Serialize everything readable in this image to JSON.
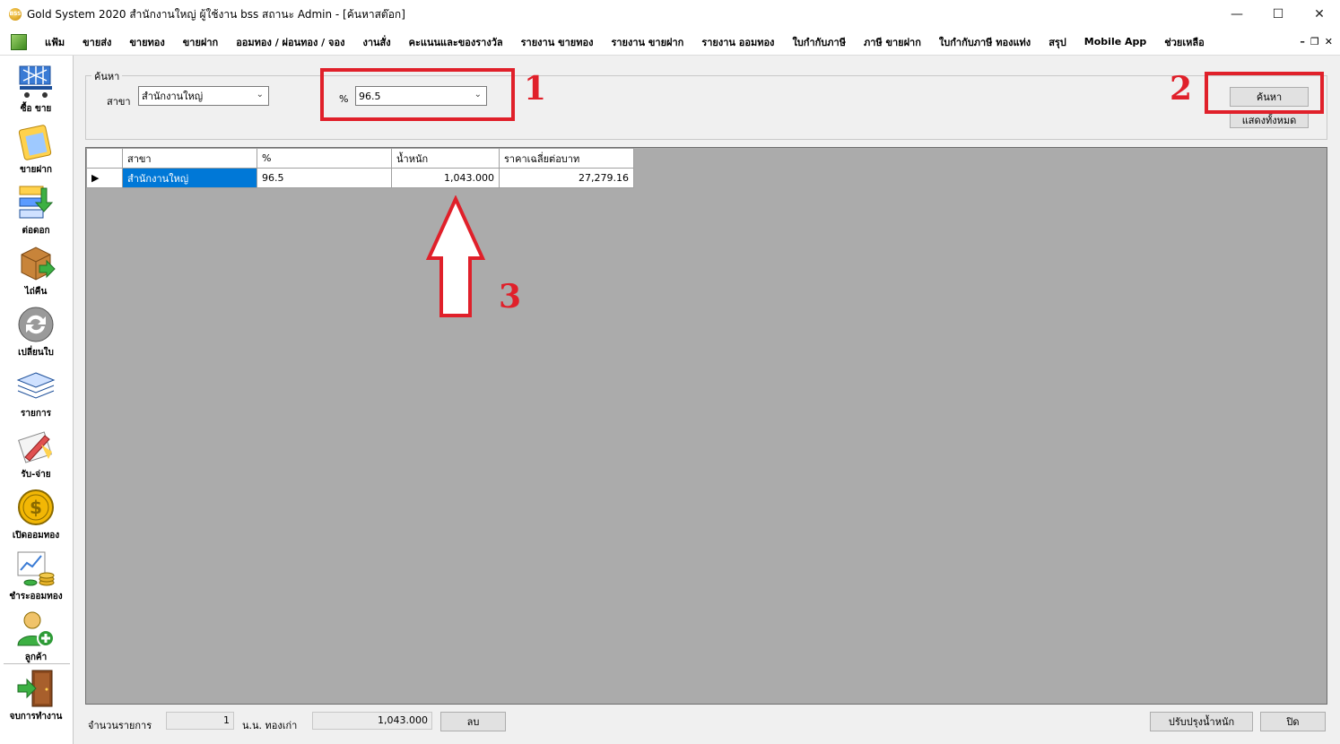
{
  "window": {
    "app_icon_text": "BSS",
    "title": "Gold System 2020  สำนักงานใหญ่ ผู้ใช้งาน bss สถานะ Admin - [ค้นหาสต๊อก]",
    "controls": {
      "minimize": "—",
      "maximize": "☐",
      "close": "✕"
    }
  },
  "menu": {
    "items": [
      "แฟ้ม",
      "ขายส่ง",
      "ขายทอง",
      "ขายฝาก",
      "ออมทอง / ผ่อนทอง / จอง",
      "งานสั่ง",
      "คะแนนและของรางวัล",
      "รายงาน ขายทอง",
      "รายงาน ขายฝาก",
      "รายงาน ออมทอง",
      "ใบกำกับภาษี",
      "ภาษี ขายฝาก",
      "ใบกำกับภาษี ทองแท่ง",
      "สรุป",
      "Mobile App",
      "ช่วยเหลือ"
    ],
    "mdi": {
      "minimize": "–",
      "restore": "❐",
      "close": "✕"
    }
  },
  "sidebar": {
    "items": [
      {
        "label": "ซื้อ ขาย",
        "icon": "cart-icon"
      },
      {
        "label": "ขายฝาก",
        "icon": "clipboard-icon"
      },
      {
        "label": "ต่อดอก",
        "icon": "transfer-icon"
      },
      {
        "label": "ไถ่คืน",
        "icon": "box-return-icon"
      },
      {
        "label": "เปลี่ยนใบ",
        "icon": "exchange-icon"
      },
      {
        "label": "รายการ",
        "icon": "layers-icon"
      },
      {
        "label": "รับ-จ่าย",
        "icon": "pen-paper-icon"
      },
      {
        "label": "เปิดออมทอง",
        "icon": "coin-icon"
      },
      {
        "label": "ชำระออมทอง",
        "icon": "chart-coins-icon"
      },
      {
        "label": "ลูกค้า",
        "icon": "customer-add-icon"
      },
      {
        "label": "จบการทำงาน",
        "icon": "exit-door-icon"
      }
    ]
  },
  "search": {
    "group_label": "ค้นหา",
    "branch_label": "สาขา",
    "branch_value": "สำนักงานใหญ่",
    "percent_label": "%",
    "percent_value": "96.5",
    "search_button": "ค้นหา",
    "show_all_button": "แสดงทั้งหมด"
  },
  "annotations": {
    "one": "1",
    "two": "2",
    "three": "3"
  },
  "grid": {
    "columns": [
      "สาขา",
      "%",
      "น้ำหนัก",
      "ราคาเฉลี่ยต่อบาท"
    ],
    "rows": [
      {
        "marker": "▶",
        "branch": "สำนักงานใหญ่",
        "percent": "96.5",
        "weight": "1,043.000",
        "avg_price": "27,279.16"
      }
    ]
  },
  "footer": {
    "count_label": "จำนวนรายการ",
    "count_value": "1",
    "old_gold_label": "น.น. ทองเก่า",
    "old_gold_value": "1,043.000",
    "delete_button": "ลบ",
    "adjust_button": "ปรับปรุงน้ำหนัก",
    "close_button": "ปิด"
  },
  "colors": {
    "annotation": "#e0202a",
    "selection": "#0078d7",
    "grid_bg": "#ababab"
  }
}
